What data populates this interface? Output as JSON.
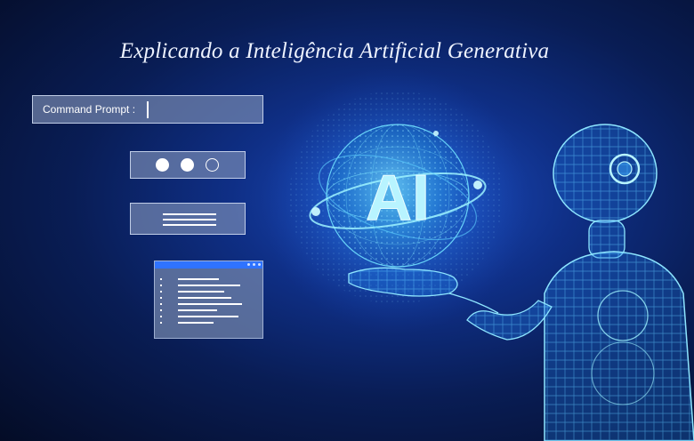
{
  "title": "Explicando a Inteligência Artificial Generativa",
  "command_prompt": {
    "label": "Command Prompt :"
  },
  "progress_dots": {
    "total": 3,
    "filled": 2
  },
  "globe": {
    "text": "AI"
  },
  "icons": [
    "cursor-icon",
    "hamburger-menu-icon",
    "code-document-icon",
    "robot-illustration",
    "ai-globe-icon",
    "hand-icon"
  ],
  "colors": {
    "accent": "#4fd8ff",
    "panel": "#8496bc",
    "background": "#0b2463"
  }
}
